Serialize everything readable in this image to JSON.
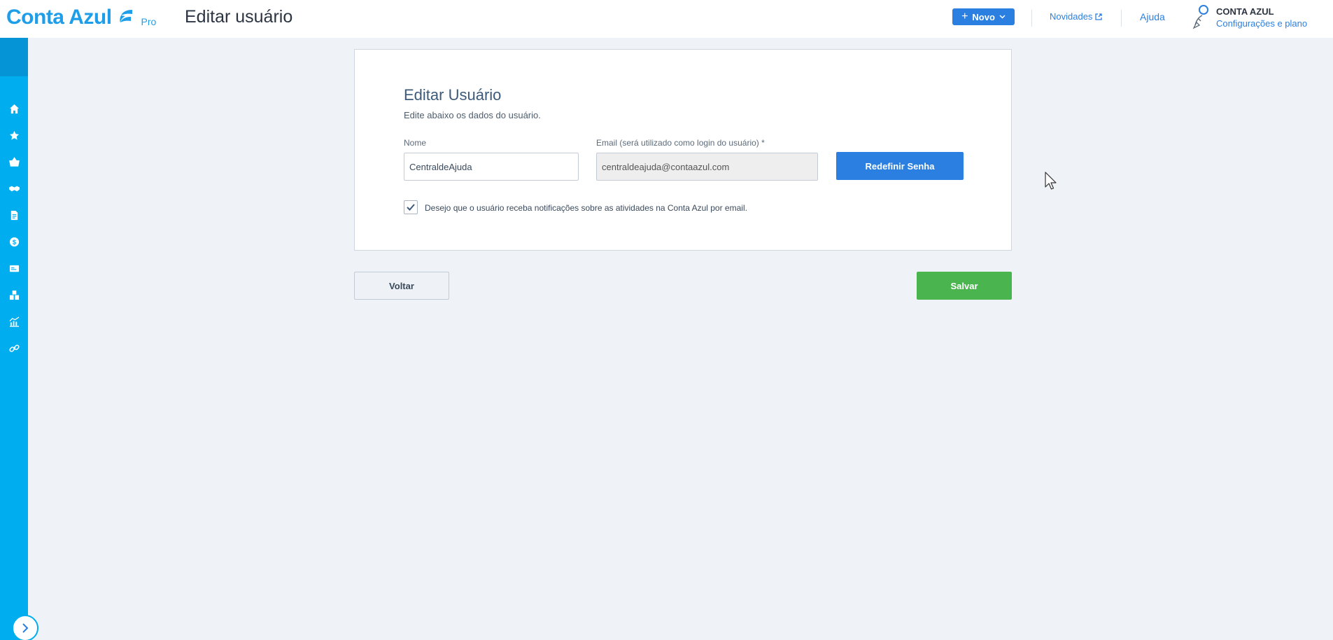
{
  "header": {
    "brand": "Conta Azul",
    "brand_tier": "Pro",
    "page_title": "Editar usuário",
    "new_button": "Novo",
    "news_link": "Novidades",
    "help_link": "Ajuda",
    "account_name": "CONTA AZUL",
    "account_link": "Configurações e plano"
  },
  "sidebar": {
    "items": [
      {
        "icon": "home-icon"
      },
      {
        "icon": "star-icon"
      },
      {
        "icon": "basket-icon"
      },
      {
        "icon": "handshake-icon"
      },
      {
        "icon": "document-icon"
      },
      {
        "icon": "dollar-icon"
      },
      {
        "icon": "card-icon"
      },
      {
        "icon": "boxes-icon"
      },
      {
        "icon": "chart-icon"
      },
      {
        "icon": "link-icon"
      }
    ]
  },
  "form": {
    "title": "Editar Usuário",
    "subtitle": "Edite abaixo os dados do usuário.",
    "name_label": "Nome",
    "name_value": "CentraldeAjuda",
    "email_label": "Email (será utilizado como login do usuário) *",
    "email_value": "centraldeajuda@contaazul.com",
    "reset_password_button": "Redefinir Senha",
    "notify_checked": true,
    "notify_label": "Desejo que o usuário receba notificações sobre as atividades na Conta Azul por email."
  },
  "actions": {
    "back_button": "Voltar",
    "save_button": "Salvar"
  },
  "colors": {
    "brand": "#1e9ee8",
    "primary": "#2a7fe0",
    "sidebar": "#00aeef",
    "success": "#4ab54e"
  }
}
